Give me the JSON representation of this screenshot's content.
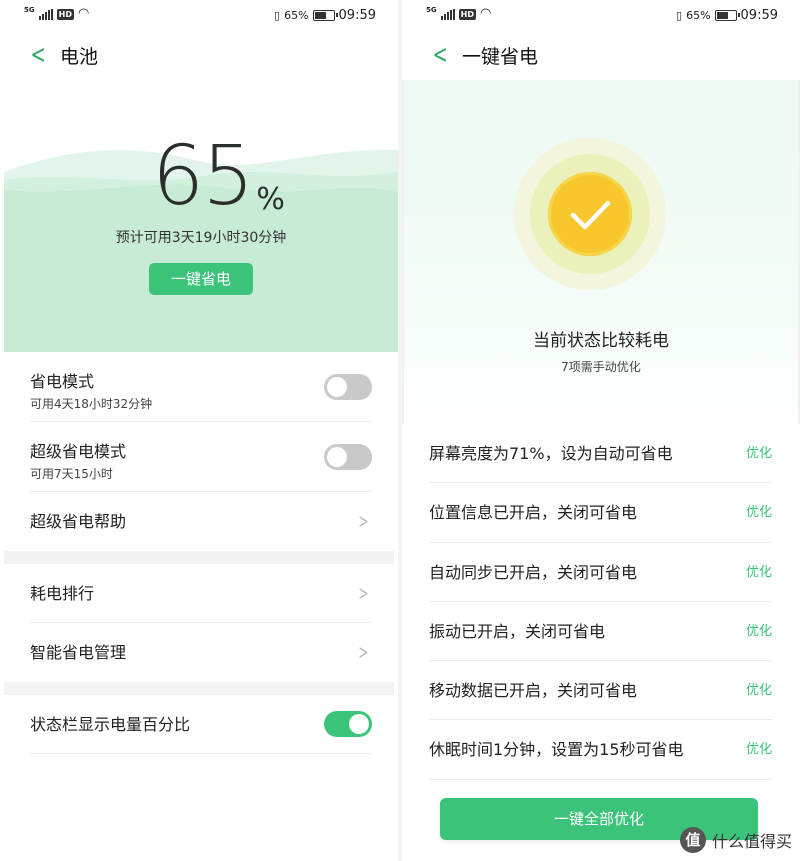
{
  "status_bar": {
    "network": "5G",
    "hd": "HD",
    "battery_percent": "65%",
    "battery_level": 0.65,
    "time": "09:59"
  },
  "battery_screen": {
    "title": "电池",
    "percent_number": "65",
    "percent_sign": "%",
    "estimate": "预计可用3天19小时30分钟",
    "one_click_button": "一键省电",
    "accent_color": "#3cc37a",
    "items": [
      {
        "label": "省电模式",
        "sub": "可用4天18小时32分钟",
        "control": "toggle",
        "on": false
      },
      {
        "label": "超级省电模式",
        "sub": "可用7天15小时",
        "control": "toggle",
        "on": false
      },
      {
        "label": "超级省电帮助",
        "control": "chevron"
      },
      {
        "label": "耗电排行",
        "control": "chevron"
      },
      {
        "label": "智能省电管理",
        "control": "chevron"
      },
      {
        "label": "状态栏显示电量百分比",
        "control": "toggle",
        "on": true
      }
    ]
  },
  "optimize_screen": {
    "title": "一键省电",
    "state": "当前状态比较耗电",
    "manual_count": "7项需手动优化",
    "optimize_label": "优化",
    "tasks": [
      "屏幕亮度为71%，设为自动可省电",
      "位置信息已开启，关闭可省电",
      "自动同步已开启，关闭可省电",
      "振动已开启，关闭可省电",
      "移动数据已开启，关闭可省电",
      "休眠时间1分钟，设置为15秒可省电"
    ],
    "optimize_all_button": "一键全部优化",
    "status_color": "#f7c72d"
  },
  "watermark": {
    "icon": "值",
    "text": "什么值得买"
  }
}
